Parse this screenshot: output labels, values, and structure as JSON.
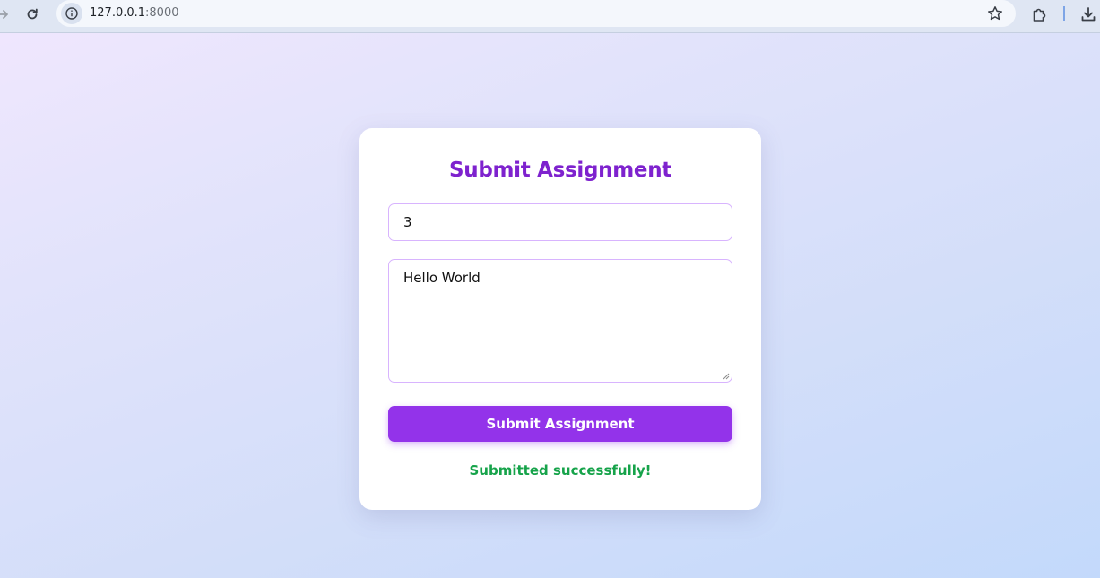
{
  "browser": {
    "url_host": "127.0.0.1",
    "url_port": ":8000",
    "icons": {
      "forward": "forward-arrow-icon",
      "reload": "reload-icon",
      "info": "site-info-icon",
      "bookmark": "star-icon",
      "extensions": "puzzle-icon",
      "download": "download-icon"
    }
  },
  "form": {
    "title": "Submit Assignment",
    "id_value": "3",
    "content_value": "Hello World",
    "submit_label": "Submit Assignment",
    "status_message": "Submitted successfully!"
  },
  "colors": {
    "accent": "#9333ea",
    "title": "#7e22ce",
    "success": "#16a34a",
    "field_border": "#d8b4fe"
  }
}
